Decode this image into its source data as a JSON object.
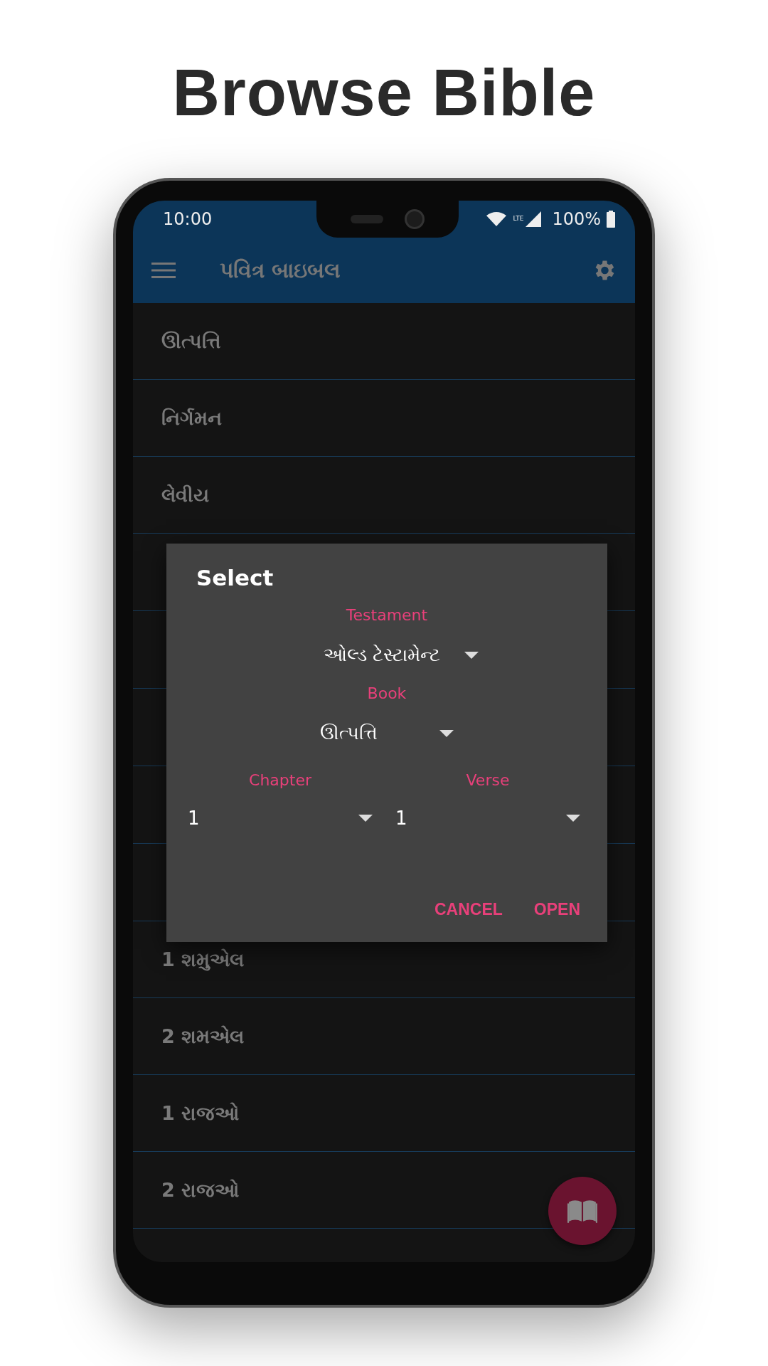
{
  "headline": "Browse Bible",
  "status_bar": {
    "time": "10:00",
    "network": "LTE",
    "battery": "100%"
  },
  "app_bar": {
    "title": "પવિત્ર બાઇબલ"
  },
  "books_above": [
    {
      "name": "ઊત્પત્તિ"
    },
    {
      "name": "નિર્ગમન"
    },
    {
      "name": "લેવીય"
    }
  ],
  "books_below": [
    {
      "name": "1 શમુએલ"
    },
    {
      "name": "2 શમએલ"
    },
    {
      "name": "1 રાજઓ"
    },
    {
      "name": "2 રાજઓ"
    }
  ],
  "dialog": {
    "title": "Select",
    "testament": {
      "label": "Testament",
      "value": "ઓલ્ડ ટેસ્ટામેન્ટ"
    },
    "book": {
      "label": "Book",
      "value": "ઊત્પત્તિ"
    },
    "chapter": {
      "label": "Chapter",
      "value": "1"
    },
    "verse": {
      "label": "Verse",
      "value": "1"
    },
    "buttons": [
      "CANCEL",
      "OPEN"
    ]
  }
}
